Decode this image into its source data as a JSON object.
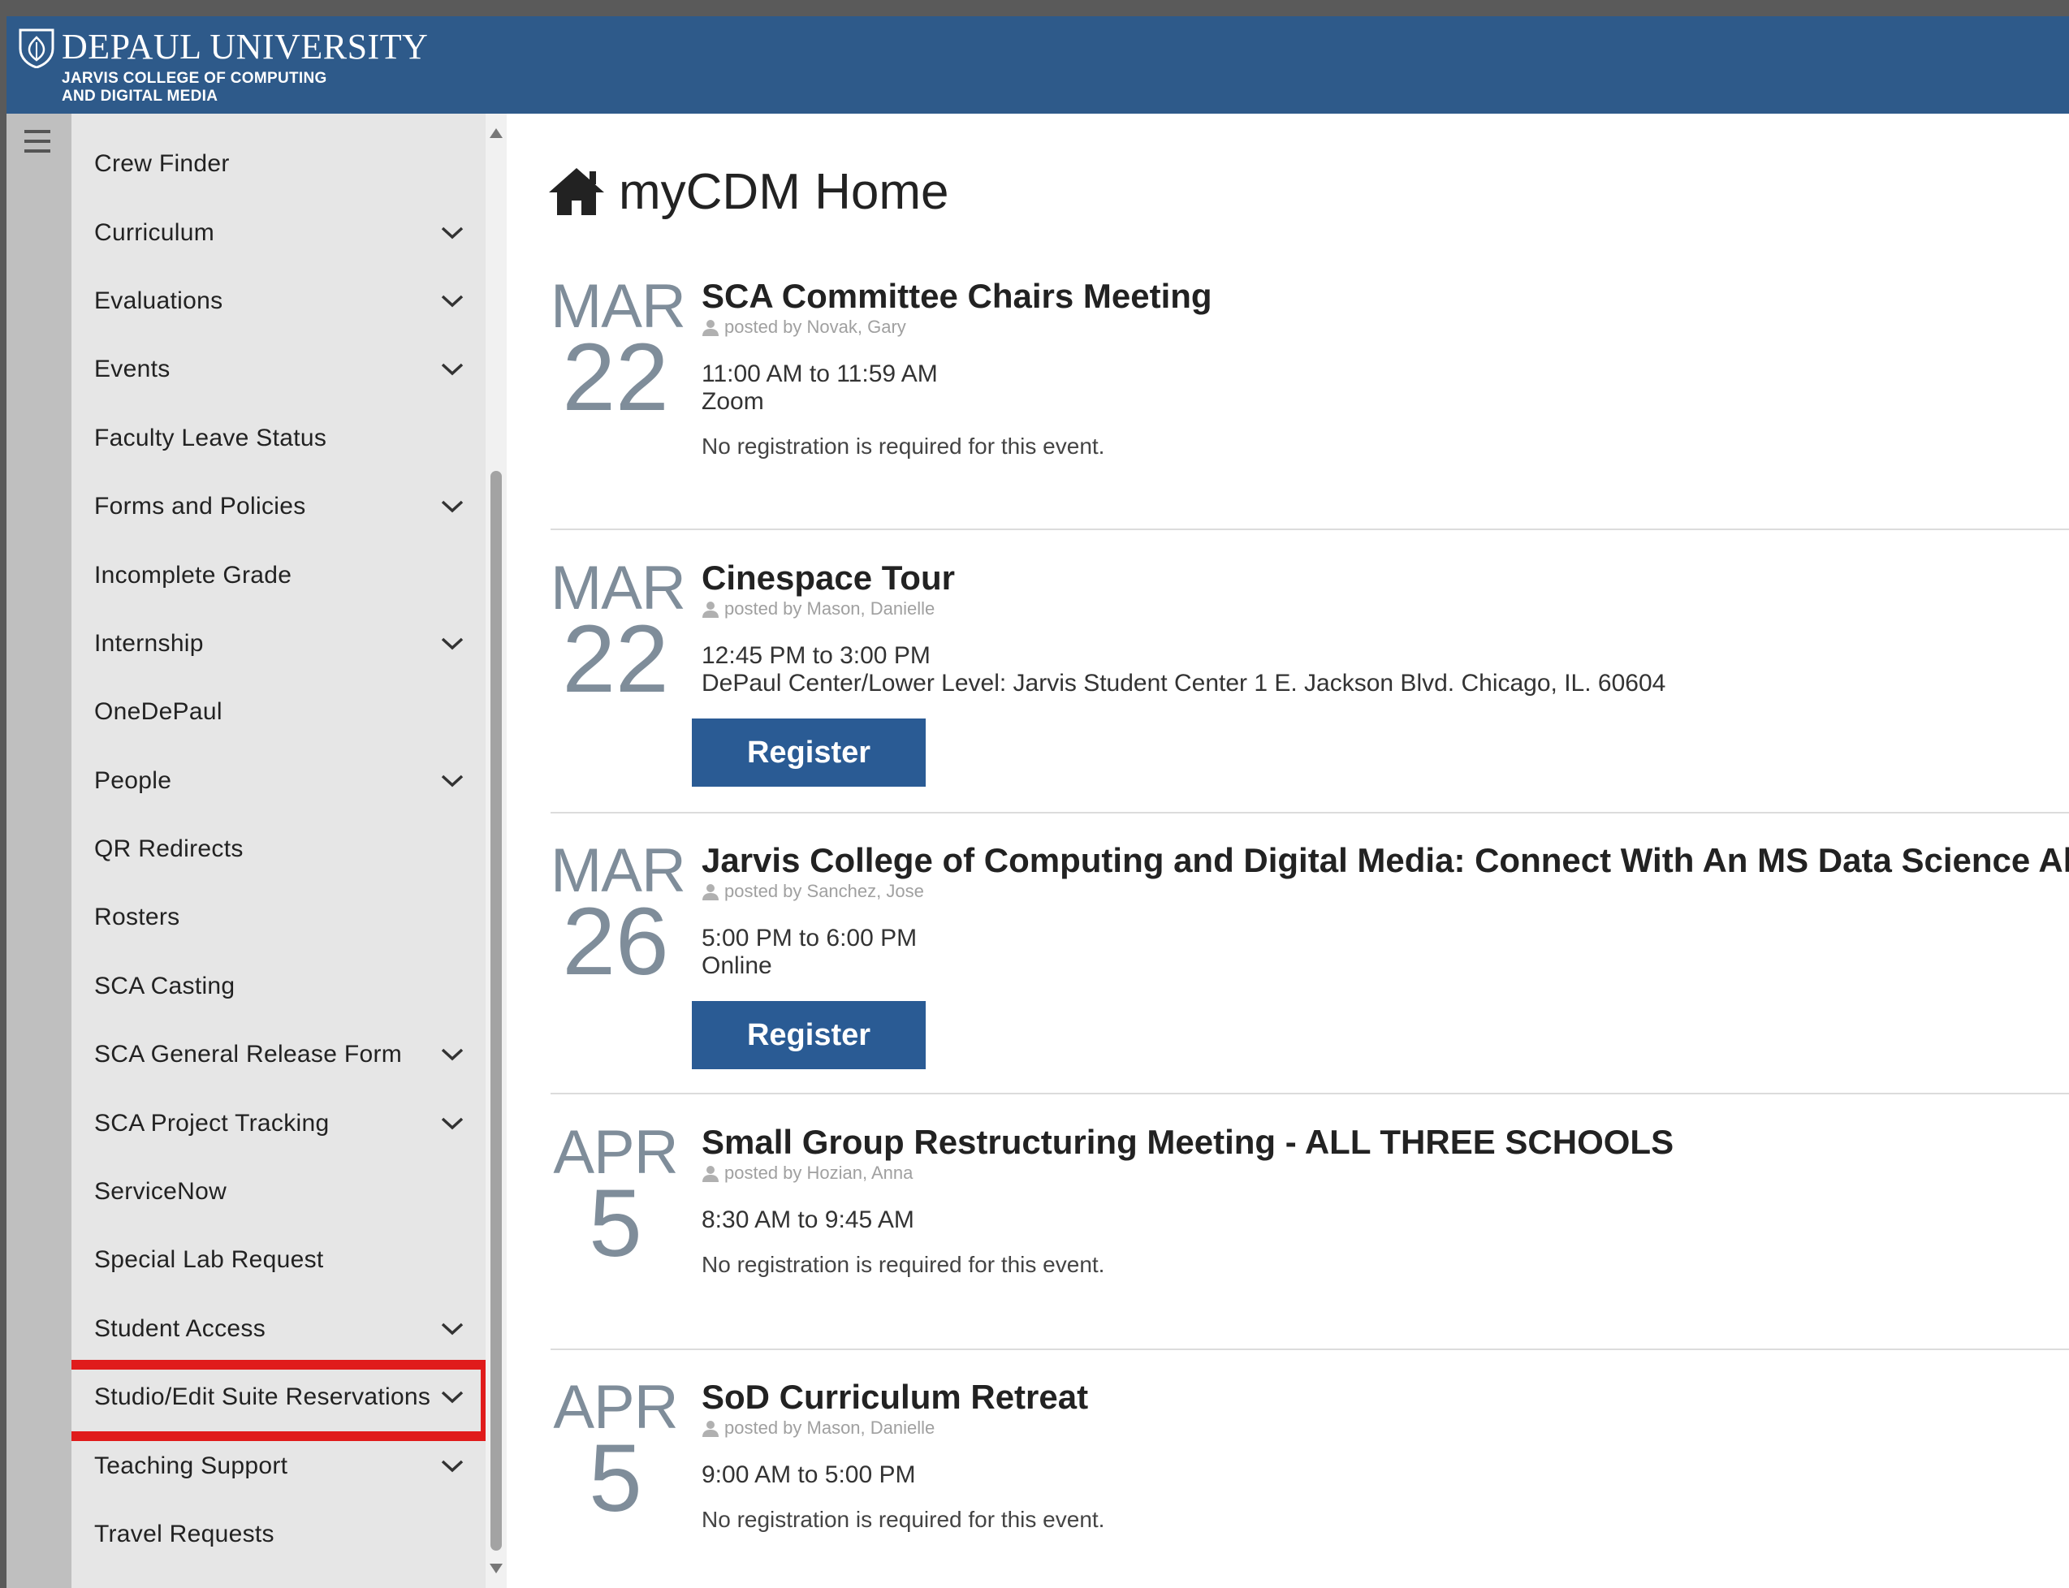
{
  "header": {
    "brand_name": "DEPAUL UNIVERSITY",
    "brand_sub_line1": "JARVIS COLLEGE OF COMPUTING",
    "brand_sub_line2": "AND DIGITAL MEDIA"
  },
  "sidebar": {
    "items": [
      {
        "label": "Crew Finder",
        "has_submenu": false
      },
      {
        "label": "Curriculum",
        "has_submenu": true
      },
      {
        "label": "Evaluations",
        "has_submenu": true
      },
      {
        "label": "Events",
        "has_submenu": true
      },
      {
        "label": "Faculty Leave Status",
        "has_submenu": false
      },
      {
        "label": "Forms and Policies",
        "has_submenu": true
      },
      {
        "label": "Incomplete Grade",
        "has_submenu": false
      },
      {
        "label": "Internship",
        "has_submenu": true
      },
      {
        "label": "OneDePaul",
        "has_submenu": false
      },
      {
        "label": "People",
        "has_submenu": true
      },
      {
        "label": "QR Redirects",
        "has_submenu": false
      },
      {
        "label": "Rosters",
        "has_submenu": false
      },
      {
        "label": "SCA Casting",
        "has_submenu": false
      },
      {
        "label": "SCA General Release Form",
        "has_submenu": true
      },
      {
        "label": "SCA Project Tracking",
        "has_submenu": true
      },
      {
        "label": "ServiceNow",
        "has_submenu": false
      },
      {
        "label": "Special Lab Request",
        "has_submenu": false
      },
      {
        "label": "Student Access",
        "has_submenu": true
      },
      {
        "label": "Studio/Edit Suite Reservations",
        "has_submenu": true,
        "highlighted": true
      },
      {
        "label": "Teaching Support",
        "has_submenu": true
      },
      {
        "label": "Travel Requests",
        "has_submenu": false
      }
    ]
  },
  "main": {
    "title": "myCDM Home",
    "events": [
      {
        "month": "MAR",
        "day": "22",
        "title": "SCA Committee Chairs Meeting",
        "posted_by": "posted by Novak, Gary",
        "time": "11:00 AM to 11:59 AM",
        "location": "Zoom",
        "note": "No registration is required for this event."
      },
      {
        "month": "MAR",
        "day": "22",
        "title": "Cinespace Tour",
        "posted_by": "posted by Mason, Danielle",
        "time": "12:45 PM to 3:00 PM",
        "location": "DePaul Center/Lower Level: Jarvis Student Center 1 E. Jackson Blvd. Chicago, IL. 60604",
        "register_label": "Register"
      },
      {
        "month": "MAR",
        "day": "26",
        "title": "Jarvis College of Computing and Digital Media: Connect With An MS Data Science Alum",
        "posted_by": "posted by Sanchez, Jose",
        "time": "5:00 PM to 6:00 PM",
        "location": "Online",
        "register_label": "Register"
      },
      {
        "month": "APR",
        "day": "5",
        "title": "Small Group Restructuring Meeting - ALL THREE SCHOOLS",
        "posted_by": "posted by Hozian, Anna",
        "time": "8:30 AM to 9:45 AM",
        "note": "No registration is required for this event."
      },
      {
        "month": "APR",
        "day": "5",
        "title": "SoD Curriculum Retreat",
        "posted_by": "posted by Mason, Danielle",
        "time": "9:00 AM to 5:00 PM",
        "note": "No registration is required for this event."
      }
    ]
  },
  "colors": {
    "header_bg": "#2e5a8a",
    "register_button": "#2a5b94",
    "highlight_box": "#e01b1b",
    "date_text": "#7f8d9a"
  },
  "icons": {
    "logo": "depaul-shield-icon",
    "menu": "hamburger-icon",
    "home": "home-icon",
    "user": "user-icon",
    "submenu": "chevron-down-icon"
  }
}
